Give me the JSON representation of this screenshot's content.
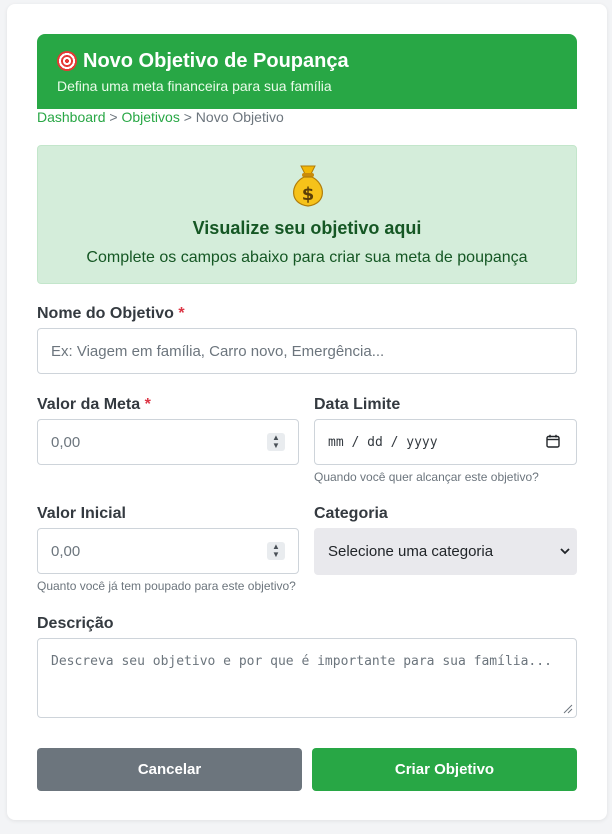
{
  "header": {
    "title": "Novo Objetivo de Poupança",
    "subtitle": "Defina uma meta financeira para sua família",
    "icon": "target-icon",
    "color": "#28a745"
  },
  "breadcrumb": {
    "items": [
      "Dashboard",
      "Objetivos",
      "Novo Objetivo"
    ],
    "separator": ">"
  },
  "preview": {
    "icon": "money-bag-icon",
    "title": "Visualize seu objetivo aqui",
    "text": "Complete os campos abaixo para criar sua meta de poupança"
  },
  "form": {
    "required_mark": "*",
    "name": {
      "label": "Nome do Objetivo",
      "placeholder": "Ex: Viagem em família, Carro novo, Emergência..."
    },
    "target_value": {
      "label": "Valor da Meta",
      "placeholder": "0,00"
    },
    "deadline": {
      "label": "Data Limite",
      "placeholder": "mm / dd / yyyy",
      "help": "Quando você quer alcançar este objetivo?"
    },
    "initial_value": {
      "label": "Valor Inicial",
      "placeholder": "0,00",
      "help": "Quanto você já tem poupado para este objetivo?"
    },
    "category": {
      "label": "Categoria",
      "selected": "Selecione uma categoria"
    },
    "description": {
      "label": "Descrição",
      "placeholder": "Descreva seu objetivo e por que é importante para sua família..."
    }
  },
  "actions": {
    "cancel_label": "Cancelar",
    "submit_label": "Criar Objetivo"
  }
}
